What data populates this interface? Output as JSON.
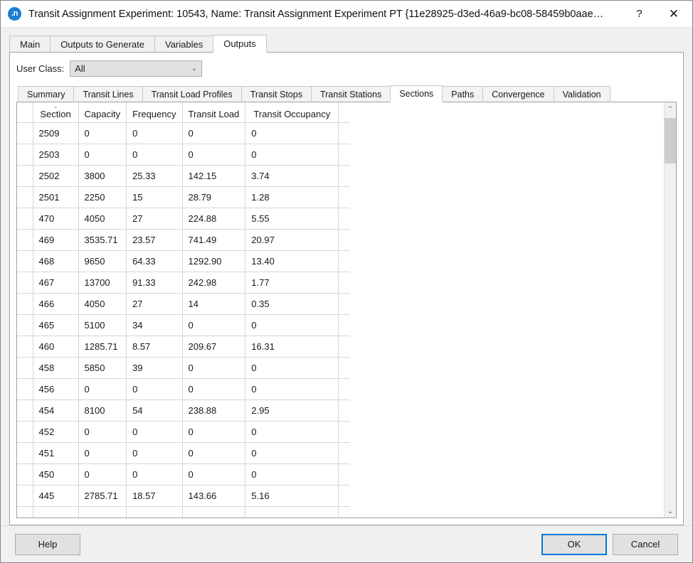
{
  "window": {
    "icon": "app-logo-icon",
    "icon_text": ".n",
    "title": "Transit Assignment Experiment: 10543, Name: Transit Assignment Experiment PT  {11e28925-d3ed-46a9-bc08-58459b0aae…",
    "help_button": "?",
    "close_button": "✕"
  },
  "tabs": [
    {
      "label": "Main",
      "active": false
    },
    {
      "label": "Outputs to Generate",
      "active": false
    },
    {
      "label": "Variables",
      "active": false
    },
    {
      "label": "Outputs",
      "active": true
    }
  ],
  "user_class": {
    "label": "User Class:",
    "value": "All",
    "chevron": "⌄"
  },
  "subtabs": [
    {
      "label": "Summary",
      "active": false
    },
    {
      "label": "Transit Lines",
      "active": false
    },
    {
      "label": "Transit Load Profiles",
      "active": false
    },
    {
      "label": "Transit Stops",
      "active": false
    },
    {
      "label": "Transit Stations",
      "active": false
    },
    {
      "label": "Sections",
      "active": true
    },
    {
      "label": "Paths",
      "active": false
    },
    {
      "label": "Convergence",
      "active": false
    },
    {
      "label": "Validation",
      "active": false
    }
  ],
  "table": {
    "sort_indicator": "⌄",
    "sort_column": "Section",
    "columns": [
      "Section",
      "Capacity",
      "Frequency",
      "Transit Load",
      "Transit Occupancy"
    ],
    "rows": [
      [
        "2509",
        "0",
        "0",
        "0",
        "0"
      ],
      [
        "2503",
        "0",
        "0",
        "0",
        "0"
      ],
      [
        "2502",
        "3800",
        "25.33",
        "142.15",
        "3.74"
      ],
      [
        "2501",
        "2250",
        "15",
        "28.79",
        "1.28"
      ],
      [
        "470",
        "4050",
        "27",
        "224.88",
        "5.55"
      ],
      [
        "469",
        "3535.71",
        "23.57",
        "741.49",
        "20.97"
      ],
      [
        "468",
        "9650",
        "64.33",
        "1292.90",
        "13.40"
      ],
      [
        "467",
        "13700",
        "91.33",
        "242.98",
        "1.77"
      ],
      [
        "466",
        "4050",
        "27",
        "14",
        "0.35"
      ],
      [
        "465",
        "5100",
        "34",
        "0",
        "0"
      ],
      [
        "460",
        "1285.71",
        "8.57",
        "209.67",
        "16.31"
      ],
      [
        "458",
        "5850",
        "39",
        "0",
        "0"
      ],
      [
        "456",
        "0",
        "0",
        "0",
        "0"
      ],
      [
        "454",
        "8100",
        "54",
        "238.88",
        "2.95"
      ],
      [
        "452",
        "0",
        "0",
        "0",
        "0"
      ],
      [
        "451",
        "0",
        "0",
        "0",
        "0"
      ],
      [
        "450",
        "0",
        "0",
        "0",
        "0"
      ],
      [
        "445",
        "2785.71",
        "18.57",
        "143.66",
        "5.16"
      ],
      [
        "",
        "",
        "",
        "",
        ""
      ]
    ]
  },
  "scrollbar": {
    "up_arrow": "⌃",
    "down_arrow": "⌄"
  },
  "footer": {
    "help_label": "Help",
    "ok_label": "OK",
    "cancel_label": "Cancel"
  },
  "colors": {
    "accent": "#0078d7",
    "titlebar_bg": "#ffffff",
    "dialog_bg": "#f0f0f0",
    "panel_bg": "#ffffff",
    "grid_line": "#d6d6d6",
    "icon_blue": "#1b7fd4"
  }
}
